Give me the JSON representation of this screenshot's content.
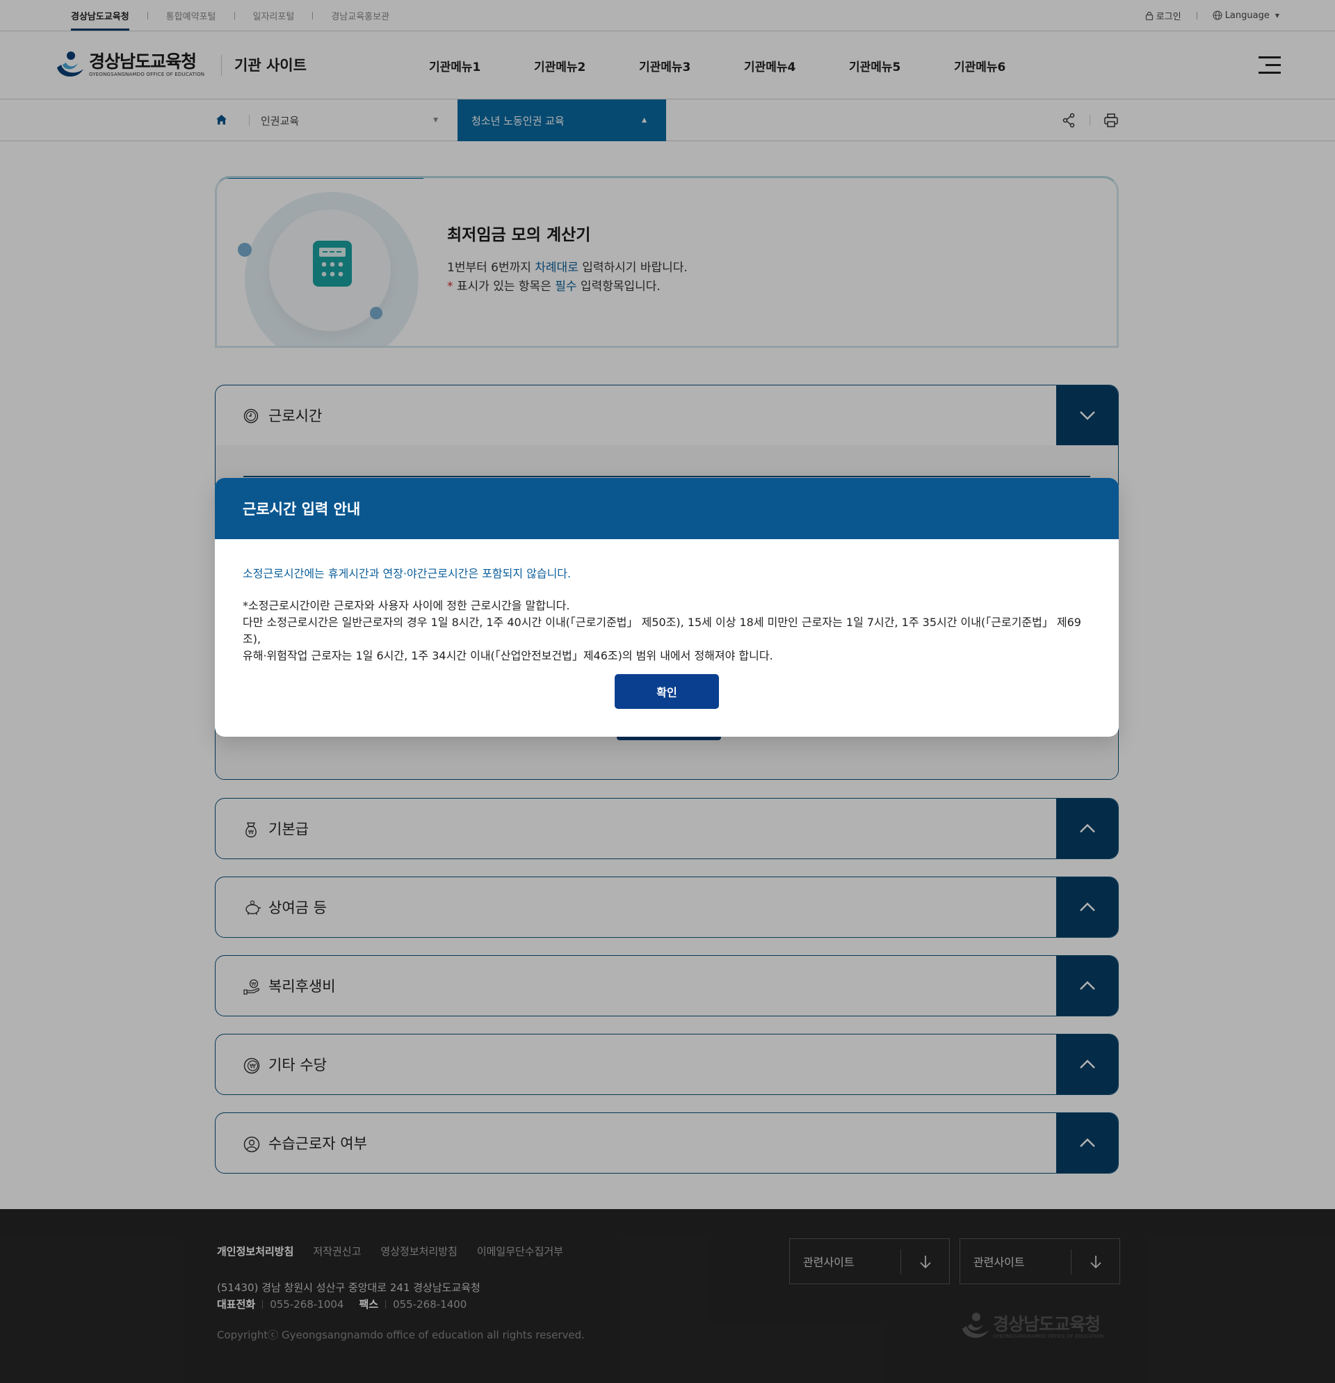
{
  "utility": {
    "sites": [
      "경상남도교육청",
      "통합예약포털",
      "일자리포털",
      "경남교육홍보관"
    ],
    "login": "로그인",
    "language": "Language"
  },
  "header": {
    "logo_ko": "경상남도교육청",
    "logo_en": "GYEONGSANGNAMDO OFFICE OF EDUCATION",
    "site_name": "기관 사이트",
    "menu": [
      "기관메뉴1",
      "기관메뉴2",
      "기관메뉴3",
      "기관메뉴4",
      "기관메뉴5",
      "기관메뉴6"
    ]
  },
  "location": {
    "depth1": "인권교육",
    "depth2": "청소년 노동인권 교육"
  },
  "intro": {
    "title": "최저임금 모의 계산기",
    "line1_pre": "1번부터 6번까지 ",
    "line1_hl": "차례대로",
    "line1_post": " 입력하시기 바랍니다.",
    "line2_star": "*",
    "line2_pre": " 표시가 있는 항목은 ",
    "line2_hl": "필수",
    "line2_post": " 입력항목입니다."
  },
  "accordions": [
    {
      "title": "근로시간",
      "icon": "clock-icon",
      "expanded": true
    },
    {
      "title": "기본급",
      "icon": "money-bag-icon",
      "expanded": false
    },
    {
      "title": "상여금 등",
      "icon": "piggy-bank-icon",
      "expanded": false
    },
    {
      "title": "복리후생비",
      "icon": "hand-coin-icon",
      "expanded": false
    },
    {
      "title": "기타 수당",
      "icon": "won-coin-icon",
      "expanded": false
    },
    {
      "title": "수습근로자 여부",
      "icon": "user-circle-icon",
      "expanded": false
    }
  ],
  "modal": {
    "title": "근로시간 입력 안내",
    "lead": "소정근로시간에는 휴게시간과 연장·야간근로시간은 포함되지 않습니다.",
    "line1": "*소정근로시간이란 근로자와 사용자 사이에 정한 근로시간을 말합니다.",
    "line2": "다만 소정근로시간은 일반근로자의 경우 1일 8시간, 1주 40시간 이내(「근로기준법」 제50조), 15세 이상 18세 미만인 근로자는 1일 7시간, 1주 35시간 이내(「근로기준법」 제69조),",
    "line3": "유해·위험작업 근로자는 1일 6시간, 1주 34시간 이내(「산업안전보건법」제46조)의 범위 내에서 정해져야 합니다.",
    "confirm": "확인"
  },
  "footer": {
    "links": [
      "개인정보처리방침",
      "저작권신고",
      "영상정보처리방침",
      "이메일무단수집거부"
    ],
    "address": "(51430) 경남 창원시 성산구 중앙대로 241 경상남도교육청",
    "tel_label": "대표전화",
    "tel": "055-268-1004",
    "fax_label": "팩스",
    "fax": "055-268-1400",
    "copyright": "Copyrightⓒ Gyeongsangnamdo office of education all rights reserved.",
    "related1": "관련사이트",
    "related2": "관련사이트",
    "logo_ko": "경상남도교육청",
    "logo_en": "GYEONGSANGNAMDO OFFICE OF EDUCATION"
  },
  "colors": {
    "primary": "#0a5790",
    "accent": "#0b6aa3",
    "dark_button": "#073e66",
    "required": "#d52b2b"
  }
}
